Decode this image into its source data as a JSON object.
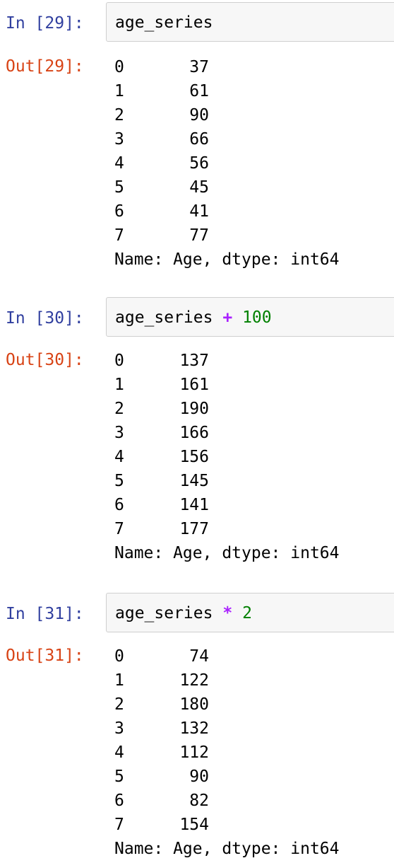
{
  "cells": [
    {
      "in_prompt": "In [29]:",
      "code": {
        "var": "age_series",
        "op": "",
        "num": ""
      },
      "out_prompt": "Out[29]:",
      "rows": [
        {
          "index": "0",
          "value": "37"
        },
        {
          "index": "1",
          "value": "61"
        },
        {
          "index": "2",
          "value": "90"
        },
        {
          "index": "3",
          "value": "66"
        },
        {
          "index": "4",
          "value": "56"
        },
        {
          "index": "5",
          "value": "45"
        },
        {
          "index": "6",
          "value": "41"
        },
        {
          "index": "7",
          "value": "77"
        }
      ],
      "footer": "Name: Age, dtype: int64"
    },
    {
      "in_prompt": "In [30]:",
      "code": {
        "var": "age_series",
        "op": "+",
        "num": "100"
      },
      "out_prompt": "Out[30]:",
      "rows": [
        {
          "index": "0",
          "value": "137"
        },
        {
          "index": "1",
          "value": "161"
        },
        {
          "index": "2",
          "value": "190"
        },
        {
          "index": "3",
          "value": "166"
        },
        {
          "index": "4",
          "value": "156"
        },
        {
          "index": "5",
          "value": "145"
        },
        {
          "index": "6",
          "value": "141"
        },
        {
          "index": "7",
          "value": "177"
        }
      ],
      "footer": "Name: Age, dtype: int64"
    },
    {
      "in_prompt": "In [31]:",
      "code": {
        "var": "age_series",
        "op": "*",
        "num": "2"
      },
      "out_prompt": "Out[31]:",
      "rows": [
        {
          "index": "0",
          "value": "74"
        },
        {
          "index": "1",
          "value": "122"
        },
        {
          "index": "2",
          "value": "180"
        },
        {
          "index": "3",
          "value": "132"
        },
        {
          "index": "4",
          "value": "112"
        },
        {
          "index": "5",
          "value": "90"
        },
        {
          "index": "6",
          "value": "82"
        },
        {
          "index": "7",
          "value": "154"
        }
      ],
      "footer": "Name: Age, dtype: int64"
    }
  ],
  "colors": {
    "in_prompt": "#303f9f",
    "out_prompt": "#d84315",
    "operator": "#aa22ff",
    "number": "#008000",
    "code_bg": "#f7f7f7"
  }
}
